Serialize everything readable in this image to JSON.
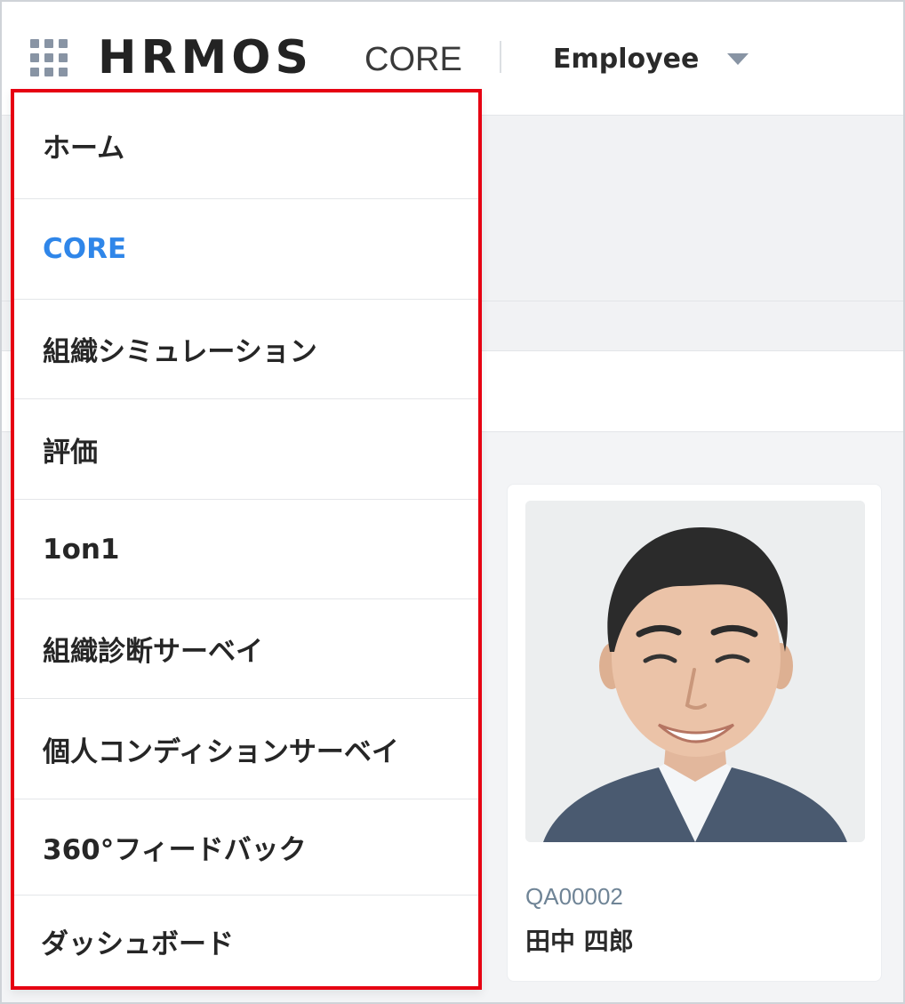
{
  "header": {
    "logo_text": "HRMOS",
    "logo_sub": "CORE",
    "role_label": "Employee"
  },
  "menu": {
    "items": [
      {
        "label": "ホーム",
        "active": false
      },
      {
        "label": "CORE",
        "active": true
      },
      {
        "label": "組織シミュレーション",
        "active": false
      },
      {
        "label": "評価",
        "active": false
      },
      {
        "label": "1on1",
        "active": false
      },
      {
        "label": "組織診断サーベイ",
        "active": false
      },
      {
        "label": "個人コンディションサーベイ",
        "active": false
      },
      {
        "label": "360°フィードバック",
        "active": false
      },
      {
        "label": "ダッシュボード",
        "active": false
      }
    ]
  },
  "employee_card": {
    "id": "QA00002",
    "name": "田中 四郎"
  },
  "colors": {
    "active_menu": "#2f86e9",
    "highlight_border": "#e60012",
    "icon_gray": "#8894a4"
  },
  "icons": {
    "apps": "grid-icon",
    "role_caret": "caret-down-icon"
  }
}
